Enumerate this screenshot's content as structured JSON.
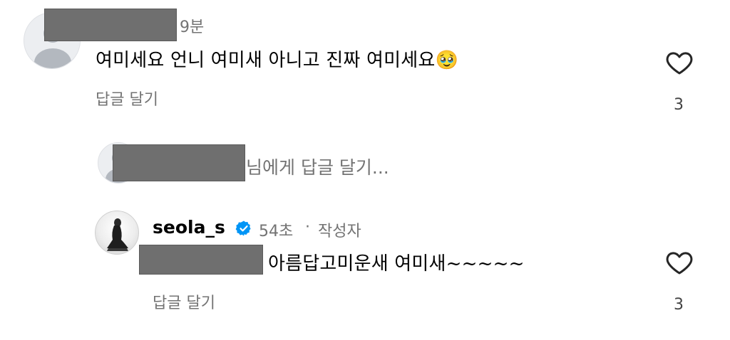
{
  "comment1": {
    "time": "9분",
    "text": "여미세요 언니 여미새 아니고 진짜 여미세요",
    "emoji": "🥹",
    "reply_label": "답글 달기",
    "like_count": "3"
  },
  "reply_prompt": {
    "suffix": "님에게 답글 달기..."
  },
  "comment2": {
    "username": "seola_s",
    "verified_icon": "verified-badge-icon",
    "time": "54초",
    "separator": "·",
    "author_tag": "작성자",
    "text": "아름답고미운새 여미새~~~~~",
    "reply_label": "답글 달기",
    "like_count": "3"
  },
  "colors": {
    "verified": "#0095f6",
    "secondary_text": "#737373",
    "redaction": "#6f6f6f"
  }
}
